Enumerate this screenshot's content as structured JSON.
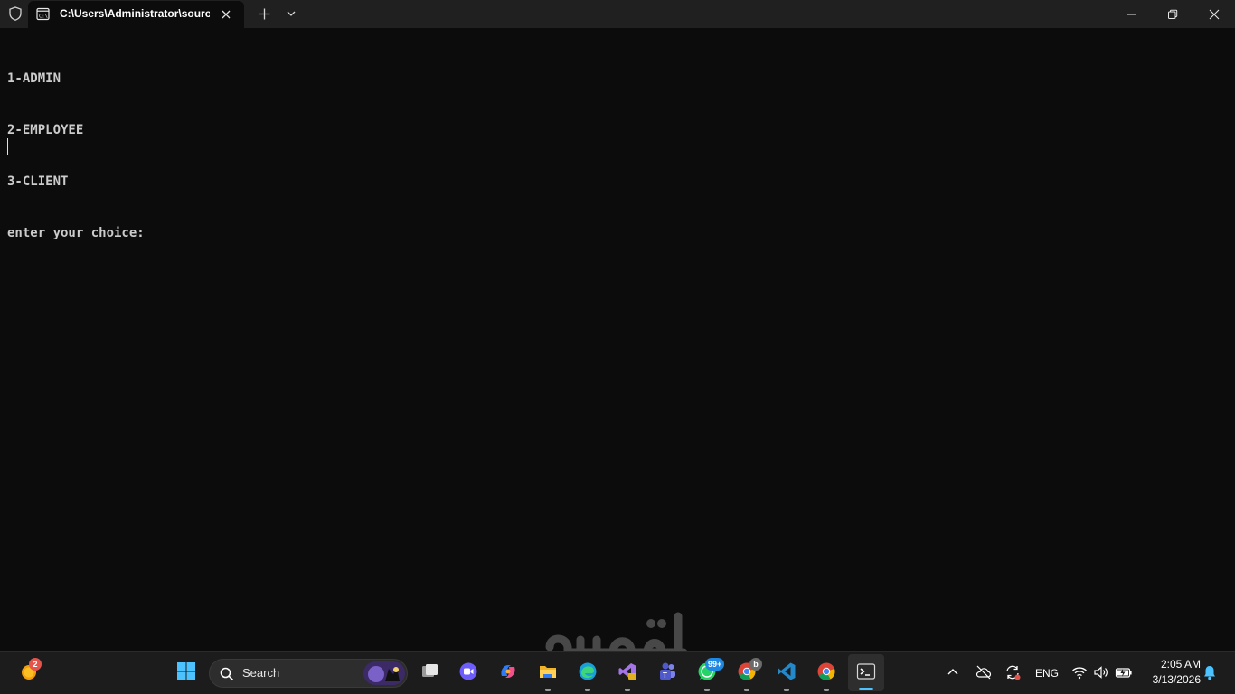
{
  "window": {
    "tab_title": "C:\\Users\\Administrator\\source"
  },
  "console": {
    "lines": [
      "1-ADMIN",
      "2-EMPLOYEE",
      "3-CLIENT",
      "enter your choice:"
    ]
  },
  "taskbar": {
    "search_label": "Search",
    "widgets_badge": "2",
    "whatsapp_badge": "99+",
    "chrome_profile_badge": "b",
    "language": "ENG",
    "time": "2:05 AM",
    "date": "3/13/2026"
  },
  "colors": {
    "console_bg": "#0c0c0c",
    "console_text": "#cccccc",
    "titlebar_bg": "#202020",
    "taskbar_bg": "#1c1c1c",
    "accent": "#4cc2ff"
  },
  "icons": {
    "shield": "shield-icon",
    "terminal": "terminal-icon",
    "close": "close-icon",
    "plus": "plus-icon",
    "chevron": "chevron-down-icon"
  }
}
